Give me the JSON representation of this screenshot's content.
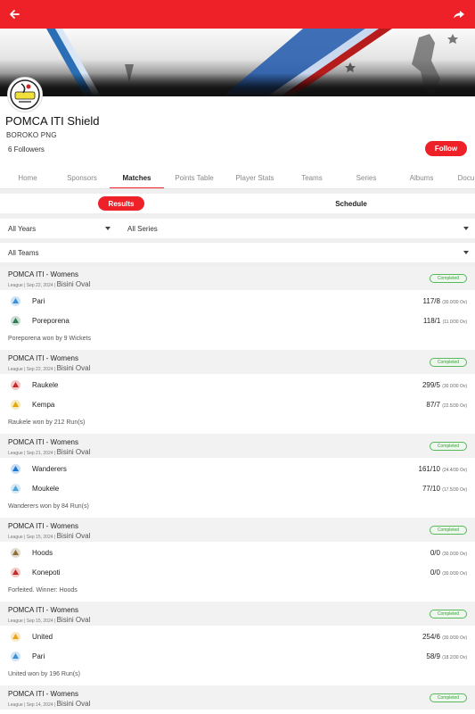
{
  "header": {
    "back_icon": "back-arrow-icon",
    "share_icon": "share-icon",
    "accent": "#ee2129"
  },
  "profile": {
    "title": "POMCA ITI Shield",
    "subtitle": "BOROKO PNG",
    "followers": "6 Followers",
    "follow_label": "Follow"
  },
  "tabs": [
    "Home",
    "Sponsors",
    "Matches",
    "Points Table",
    "Player Stats",
    "Teams",
    "Series",
    "Albums",
    "Docu"
  ],
  "active_tab": "Matches",
  "segments": {
    "results": "Results",
    "schedule": "Schedule"
  },
  "filters": {
    "years": "All Years",
    "series": "All Series",
    "teams": "All Teams"
  },
  "matches": [
    {
      "title": "POMCA ITI - Womens",
      "meta": "League | Sep 22, 2024 |",
      "venue": "Bisini Oval",
      "status": "Completed",
      "teams": [
        {
          "name": "Pari",
          "score": "117/8",
          "overs": "(30.0/30 Ov)",
          "color": "#3a8fd6"
        },
        {
          "name": "Poreporena",
          "score": "118/1",
          "overs": "(11.0/30 Ov)",
          "color": "#2e7d4f"
        }
      ],
      "result": "Poreporena won by 9 Wickets"
    },
    {
      "title": "POMCA ITI - Womens",
      "meta": "League | Sep 22, 2024 |",
      "venue": "Bisini Oval",
      "status": "Completed",
      "teams": [
        {
          "name": "Raukele",
          "score": "299/5",
          "overs": "(30.0/30 Ov)",
          "color": "#c62828"
        },
        {
          "name": "Kempa",
          "score": "87/7",
          "overs": "(22.5/30 Ov)",
          "color": "#e0a800"
        }
      ],
      "result": "Raukele won by 212 Run(s)"
    },
    {
      "title": "POMCA ITI - Womens",
      "meta": "League | Sep 21, 2024 |",
      "venue": "Bisini Oval",
      "status": "Completed",
      "teams": [
        {
          "name": "Wanderers",
          "score": "161/10",
          "overs": "(24.4/30 Ov)",
          "color": "#1976d2"
        },
        {
          "name": "Moukele",
          "score": "77/10",
          "overs": "(17.5/30 Ov)",
          "color": "#4fa3d9"
        }
      ],
      "result": "Wanderers won by 84 Run(s)"
    },
    {
      "title": "POMCA ITI - Womens",
      "meta": "League | Sep 15, 2024 |",
      "venue": "Bisini Oval",
      "status": "Completed",
      "teams": [
        {
          "name": "Hoods",
          "score": "0/0",
          "overs": "(30.0/30 Ov)",
          "color": "#8d6e3a"
        },
        {
          "name": "Konepoti",
          "score": "0/0",
          "overs": "(30.0/30 Ov)",
          "color": "#c62828"
        }
      ],
      "result": "Forfeited. Winner: Hoods"
    },
    {
      "title": "POMCA ITI - Womens",
      "meta": "League | Sep 15, 2024 |",
      "venue": "Bisini Oval",
      "status": "Completed",
      "teams": [
        {
          "name": "United",
          "score": "254/6",
          "overs": "(30.0/30 Ov)",
          "color": "#e8a317"
        },
        {
          "name": "Pari",
          "score": "58/9",
          "overs": "(18.2/30 Ov)",
          "color": "#3a8fd6"
        }
      ],
      "result": "United won by 196 Run(s)"
    },
    {
      "title": "POMCA ITI - Womens",
      "meta": "League | Sep 14, 2024 |",
      "venue": "Bisini Oval",
      "status": "Completed",
      "teams": [],
      "result": ""
    }
  ]
}
